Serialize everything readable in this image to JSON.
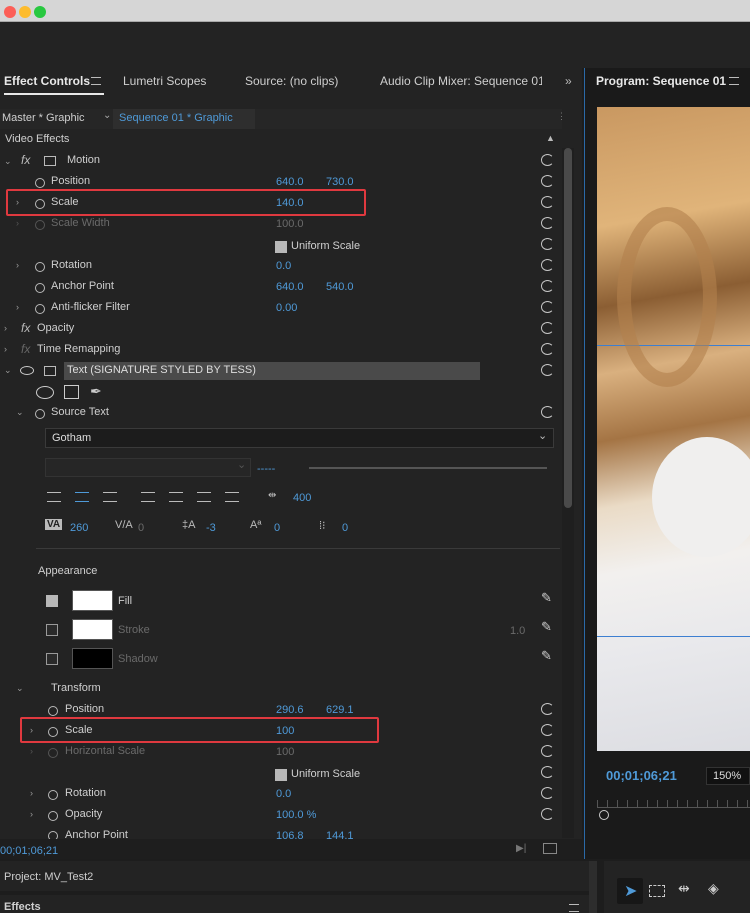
{
  "tabs": {
    "effect_controls": "Effect Controls",
    "lumetri": "Lumetri Scopes",
    "source": "Source: (no clips)",
    "audio_mixer": "Audio Clip Mixer: Sequence 01",
    "program": "Program: Sequence 01"
  },
  "breadcrumb": {
    "master": "Master * Graphic",
    "sequence": "Sequence 01 * Graphic"
  },
  "section": {
    "video_effects": "Video Effects"
  },
  "motion": {
    "label": "Motion",
    "position": {
      "label": "Position",
      "x": "640.0",
      "y": "730.0"
    },
    "scale": {
      "label": "Scale",
      "value": "140.0"
    },
    "scale_width": {
      "label": "Scale Width",
      "value": "100.0"
    },
    "uniform": "Uniform Scale",
    "rotation": {
      "label": "Rotation",
      "value": "0.0"
    },
    "anchor": {
      "label": "Anchor Point",
      "x": "640.0",
      "y": "540.0"
    },
    "antiflicker": {
      "label": "Anti-flicker Filter",
      "value": "0.00"
    }
  },
  "opacity": "Opacity",
  "time_remapping": "Time Remapping",
  "text_layer": "Text (SIGNATURE STYLED BY TESS)",
  "source_text": "Source Text",
  "font": "Gotham",
  "font_style_value": "-----",
  "tracking_value": "400",
  "kerning": {
    "va": "260",
    "va2": "0",
    "baseline": "-3",
    "tsume": "0",
    "last": "0"
  },
  "appearance": {
    "label": "Appearance",
    "fill": "Fill",
    "stroke": "Stroke",
    "stroke_width": "1.0",
    "shadow": "Shadow"
  },
  "transform": {
    "label": "Transform",
    "position": {
      "label": "Position",
      "x": "290.6",
      "y": "629.1"
    },
    "scale": {
      "label": "Scale",
      "value": "100"
    },
    "hscale": {
      "label": "Horizontal Scale",
      "value": "100"
    },
    "uniform": "Uniform Scale",
    "rotation": {
      "label": "Rotation",
      "value": "0.0"
    },
    "opacity": {
      "label": "Opacity",
      "value": "100.0 %"
    },
    "anchor": {
      "label": "Anchor Point",
      "x": "106.8",
      "y": "144.1"
    }
  },
  "timecode_left": "00;01;06;21",
  "timecode_program": "00;01;06;21",
  "zoom": "150%",
  "project": "Project: MV_Test2",
  "effects": "Effects"
}
